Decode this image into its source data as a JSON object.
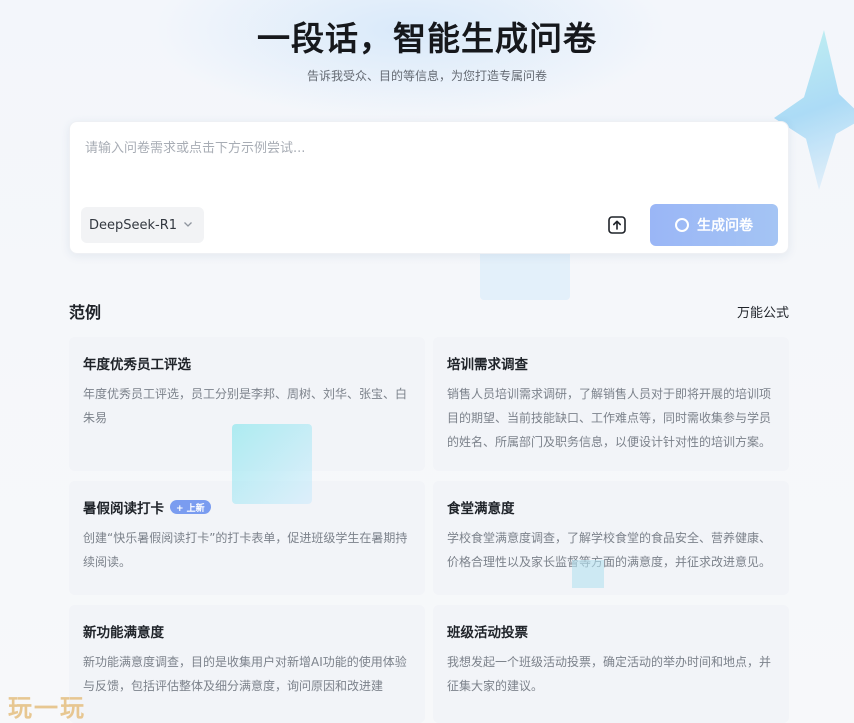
{
  "header": {
    "title": "一段话，智能生成问卷",
    "subtitle": "告诉我受众、目的等信息，为您打造专属问卷"
  },
  "input": {
    "placeholder": "请输入问卷需求或点击下方示例尝试...",
    "model": "DeepSeek-R1",
    "generate_label": "生成问卷"
  },
  "examples": {
    "title": "范例",
    "formula_link": "万能公式",
    "cards": [
      {
        "title": "年度优秀员工评选",
        "desc": "年度优秀员工评选，员工分别是李邦、周树、刘华、张宝、白朱易"
      },
      {
        "title": "培训需求调查",
        "desc": "销售人员培训需求调研，了解销售人员对于即将开展的培训项目的期望、当前技能缺口、工作难点等，同时需收集参与学员的姓名、所属部门及职务信息，以便设计针对性的培训方案。"
      },
      {
        "title": "暑假阅读打卡",
        "badge": "+ 上新",
        "desc": "创建“快乐暑假阅读打卡”的打卡表单，促进班级学生在暑期持续阅读。"
      },
      {
        "title": "食堂满意度",
        "desc": "学校食堂满意度调查，了解学校食堂的食品安全、营养健康、价格合理性以及家长监督等方面的满意度，并征求改进意见。"
      },
      {
        "title": "新功能满意度",
        "desc": "新功能满意度调查，目的是收集用户对新增AI功能的使用体验与反馈，包括评估整体及细分满意度，询问原因和改进建"
      },
      {
        "title": "班级活动投票",
        "desc": "我想发起一个班级活动投票，确定活动的举办时间和地点，并征集大家的建议。"
      }
    ]
  },
  "watermark": "玩一玩",
  "colors": {
    "accent_button": "#9ab6f6",
    "badge": "#7a9cf0",
    "card_bg": "#f1f3f7",
    "watermark": "#e6c286"
  }
}
